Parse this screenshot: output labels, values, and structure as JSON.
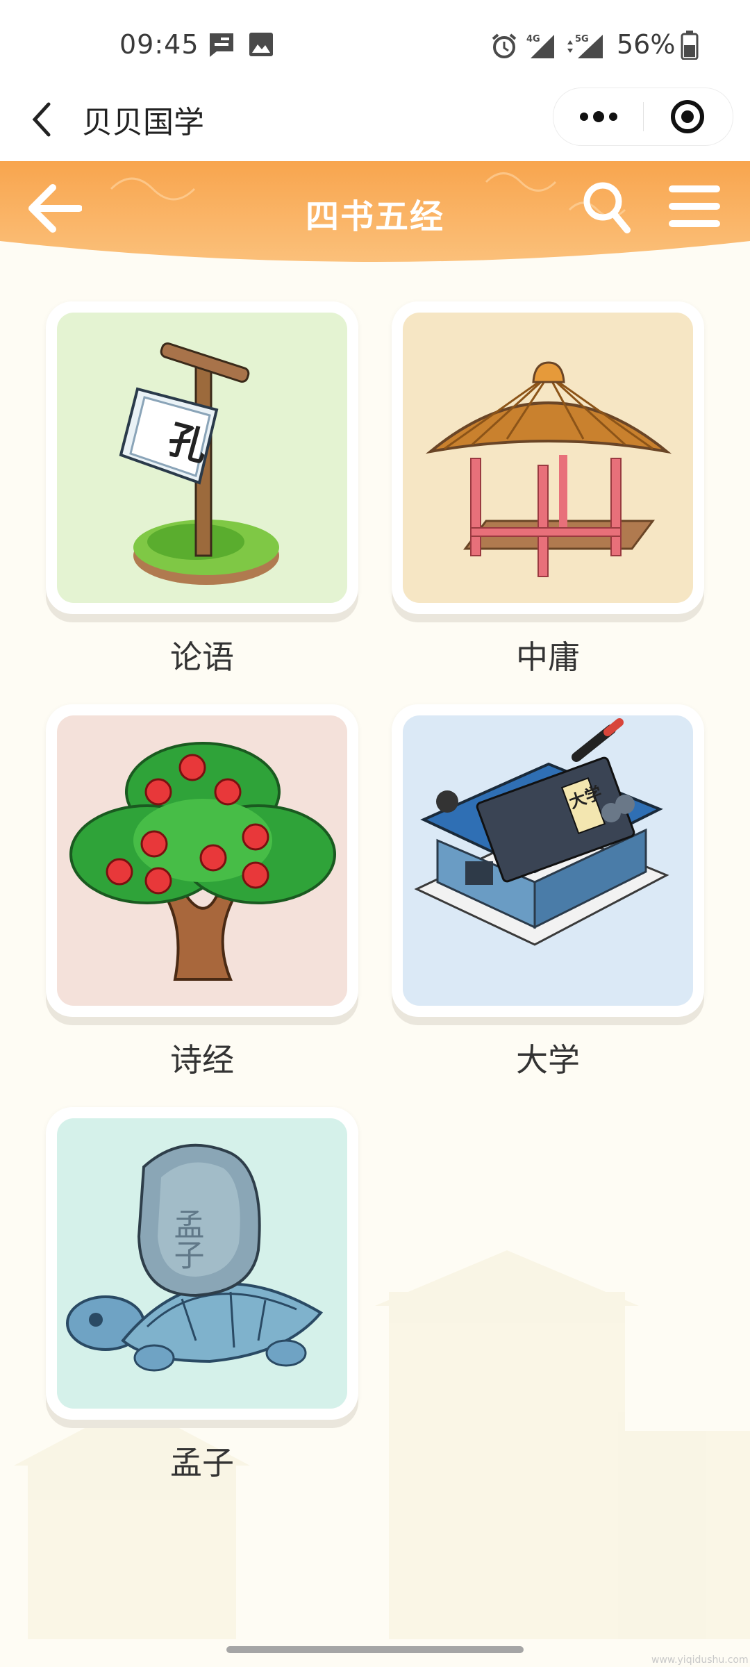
{
  "status_bar": {
    "time": "09:45",
    "battery": "56%",
    "icons": [
      "message-icon",
      "image-icon",
      "alarm-icon",
      "signal-4g-icon",
      "signal-5g-icon",
      "battery-icon"
    ]
  },
  "mini_header": {
    "title": "贝贝国学"
  },
  "nav": {
    "title": "四书五经",
    "accent": "#f6a04d"
  },
  "books": [
    {
      "label": "论语",
      "bg": "#e4f3d2",
      "icon": "confucius-sign-icon"
    },
    {
      "label": "中庸",
      "bg": "#f6e6c4",
      "icon": "pavilion-icon"
    },
    {
      "label": "诗经",
      "bg": "#f4e1da",
      "icon": "apple-tree-icon"
    },
    {
      "label": "大学",
      "bg": "#dbe9f6",
      "icon": "academy-book-icon"
    },
    {
      "label": "孟子",
      "bg": "#d5f1ea",
      "icon": "tortoise-stele-icon"
    }
  ],
  "art_text": {
    "kong": "孔",
    "daxue": "大学",
    "mengzi": "孟子"
  },
  "watermark": "www.yiqidushu.com"
}
